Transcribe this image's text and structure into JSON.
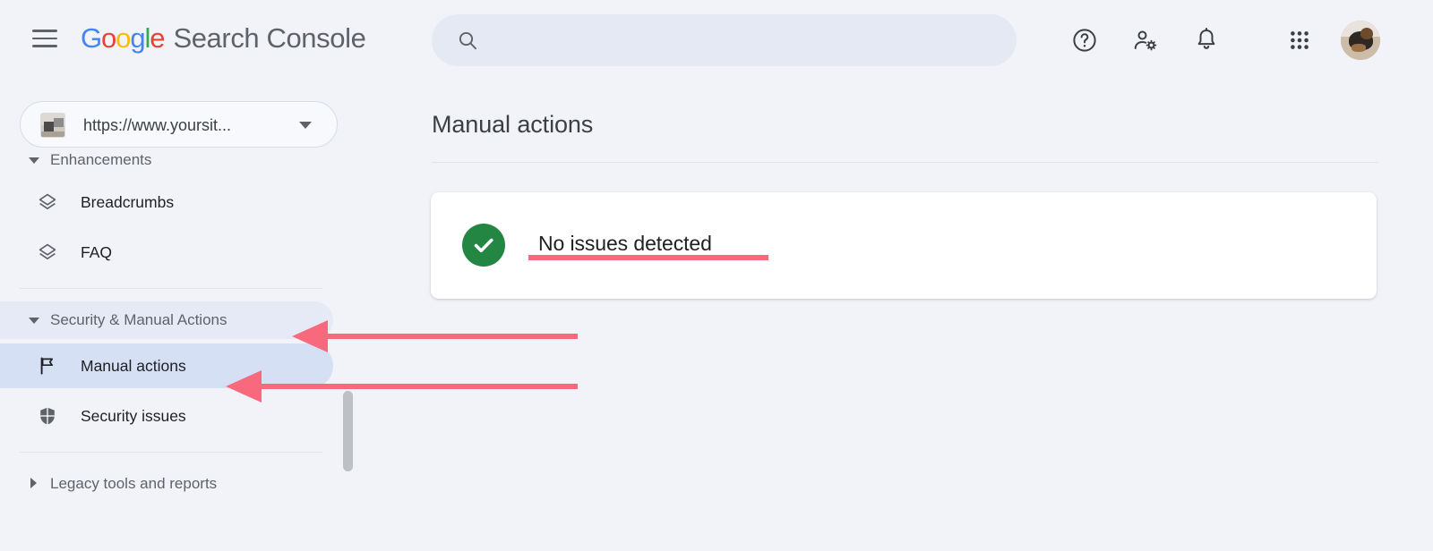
{
  "app": {
    "brand_google": "Google",
    "brand_product": "Search Console",
    "brand_letters": [
      "G",
      "o",
      "o",
      "g",
      "l",
      "e"
    ]
  },
  "colors": {
    "page_bg": "#F1F3F9",
    "card_bg": "#FFFFFF",
    "accent_selected": "#D6E0F5",
    "accent_hover": "#E6EAF6",
    "annotation_pink": "#F9697D",
    "status_green": "#248643",
    "google_blue": "#4285F4",
    "google_red": "#EA4335",
    "google_yellow": "#FBBC05",
    "google_green": "#34A853",
    "text_primary": "#202124",
    "text_secondary": "#5f6368"
  },
  "header": {
    "menu_icon": "hamburger-menu-icon",
    "search": {
      "placeholder": "",
      "value": "",
      "icon": "search-icon"
    },
    "icons": [
      {
        "name": "help-icon",
        "label": "Help"
      },
      {
        "name": "account-settings-icon",
        "label": "Users and permissions"
      },
      {
        "name": "notifications-icon",
        "label": "Notifications"
      },
      {
        "name": "apps-grid-icon",
        "label": "Google apps"
      }
    ],
    "avatar": {
      "name": "avatar",
      "label": "Google Account"
    }
  },
  "sidebar": {
    "property_selector": {
      "value": "https://www.yoursit...",
      "favicon": "site-favicon",
      "caret": "chevron-down-icon"
    },
    "sections": [
      {
        "type": "section",
        "label": "Enhancements",
        "expanded": true,
        "caret": "triangle-down-icon",
        "hovered": false,
        "clipped": true
      },
      {
        "type": "item",
        "label": "Breadcrumbs",
        "icon": "layers-icon",
        "selected": false
      },
      {
        "type": "item",
        "label": "FAQ",
        "icon": "layers-icon",
        "selected": false
      },
      {
        "type": "divider"
      },
      {
        "type": "section",
        "label": "Security & Manual Actions",
        "expanded": true,
        "caret": "triangle-down-icon",
        "hovered": true,
        "clipped": false
      },
      {
        "type": "item",
        "label": "Manual actions",
        "icon": "flag-icon",
        "selected": true
      },
      {
        "type": "item",
        "label": "Security issues",
        "icon": "shield-icon",
        "selected": false
      },
      {
        "type": "divider"
      },
      {
        "type": "section",
        "label": "Legacy tools and reports",
        "expanded": false,
        "caret": "triangle-right-icon",
        "hovered": false,
        "clipped": false
      }
    ],
    "scrollbar": {
      "name": "sidebar-scrollbar"
    }
  },
  "main": {
    "page_title": "Manual actions",
    "card": {
      "status_icon": "check-circle-icon",
      "status_text": "No issues detected"
    }
  },
  "annotations": {
    "underline": {
      "target": "No issues detected",
      "color": "#F9697D"
    },
    "arrows": [
      {
        "points_to": "Security & Manual Actions",
        "color": "#F9697D"
      },
      {
        "points_to": "Manual actions",
        "color": "#F9697D"
      }
    ]
  }
}
